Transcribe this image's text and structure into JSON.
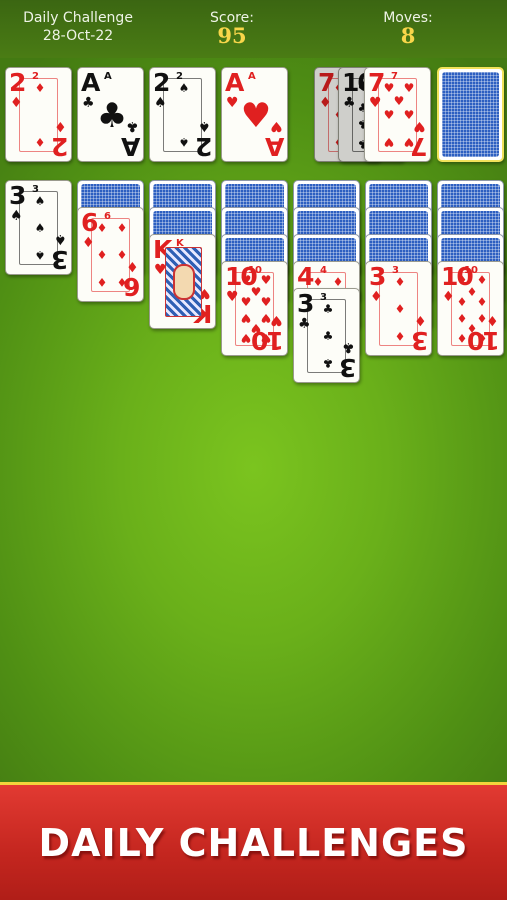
{
  "header": {
    "mode_label": "Daily Challenge",
    "date": "28-Oct-22",
    "score_label": "Score:",
    "score_value": "95",
    "moves_label": "Moves:",
    "moves_value": "8"
  },
  "foundations": [
    {
      "rank": "2",
      "suit": "♦",
      "color": "red"
    },
    {
      "rank": "A",
      "suit": "♣",
      "color": "black"
    },
    {
      "rank": "2",
      "suit": "♠",
      "color": "black"
    },
    {
      "rank": "A",
      "suit": "♥",
      "color": "red"
    }
  ],
  "waste": [
    {
      "rank": "7",
      "suit": "♦",
      "color": "red"
    },
    {
      "rank": "10",
      "suit": "♣",
      "color": "black"
    },
    {
      "rank": "7",
      "suit": "♥",
      "color": "red"
    }
  ],
  "tableau": [
    {
      "face_down": 0,
      "face_up": [
        {
          "rank": "3",
          "suit": "♠",
          "color": "black"
        }
      ]
    },
    {
      "face_down": 1,
      "face_up": [
        {
          "rank": "6",
          "suit": "♦",
          "color": "red"
        }
      ]
    },
    {
      "face_down": 2,
      "face_up": [
        {
          "rank": "K",
          "suit": "♥",
          "color": "red",
          "face": true
        }
      ]
    },
    {
      "face_down": 3,
      "face_up": [
        {
          "rank": "10",
          "suit": "♥",
          "color": "red"
        }
      ]
    },
    {
      "face_down": 3,
      "face_up": [
        {
          "rank": "4",
          "suit": "♦",
          "color": "red"
        },
        {
          "rank": "3",
          "suit": "♣",
          "color": "black"
        }
      ]
    },
    {
      "face_down": 3,
      "face_up": [
        {
          "rank": "3",
          "suit": "♦",
          "color": "red"
        }
      ]
    },
    {
      "face_down": 3,
      "face_up": [
        {
          "rank": "10",
          "suit": "♦",
          "color": "red"
        }
      ]
    }
  ],
  "banner": {
    "text": "DAILY CHALLENGES"
  },
  "colors": {
    "felt": "#6ab01a",
    "card_red": "#e02020",
    "card_black": "#111111",
    "card_back": "#2d5fc1",
    "banner_red": "#c4261f",
    "score_yellow": "#f8d64a"
  }
}
